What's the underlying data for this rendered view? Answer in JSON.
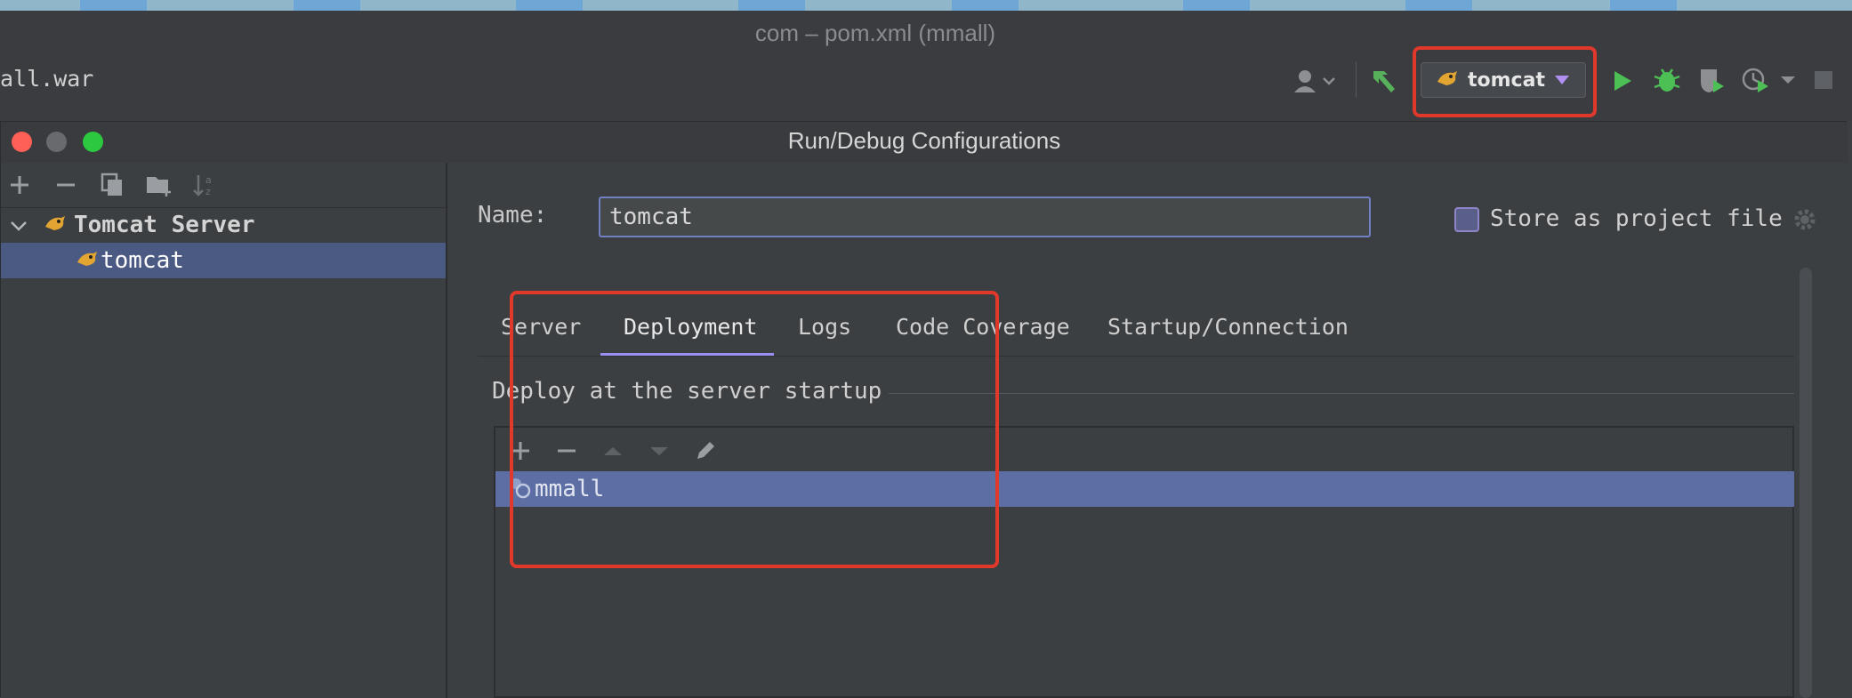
{
  "ide": {
    "window_title": "com – pom.xml (mmall)",
    "artifact_label": "all.war",
    "run_config": {
      "name": "tomcat"
    }
  },
  "dialog": {
    "title": "Run/Debug Configurations",
    "tree": {
      "group": "Tomcat Server",
      "item": "tomcat"
    },
    "name_label": "Name:",
    "name_value": "tomcat",
    "store_label": "Store as project file",
    "store_checked": false,
    "tabs": [
      "Server",
      "Deployment",
      "Logs",
      "Code Coverage",
      "Startup/Connection"
    ],
    "active_tab": "Deployment",
    "section_title": "Deploy at the server startup",
    "deploy_items": [
      "mmall"
    ]
  },
  "colors": {
    "highlight": "#e0392b",
    "selection": "#5c6ea3",
    "run_green": "#4cbf55"
  }
}
